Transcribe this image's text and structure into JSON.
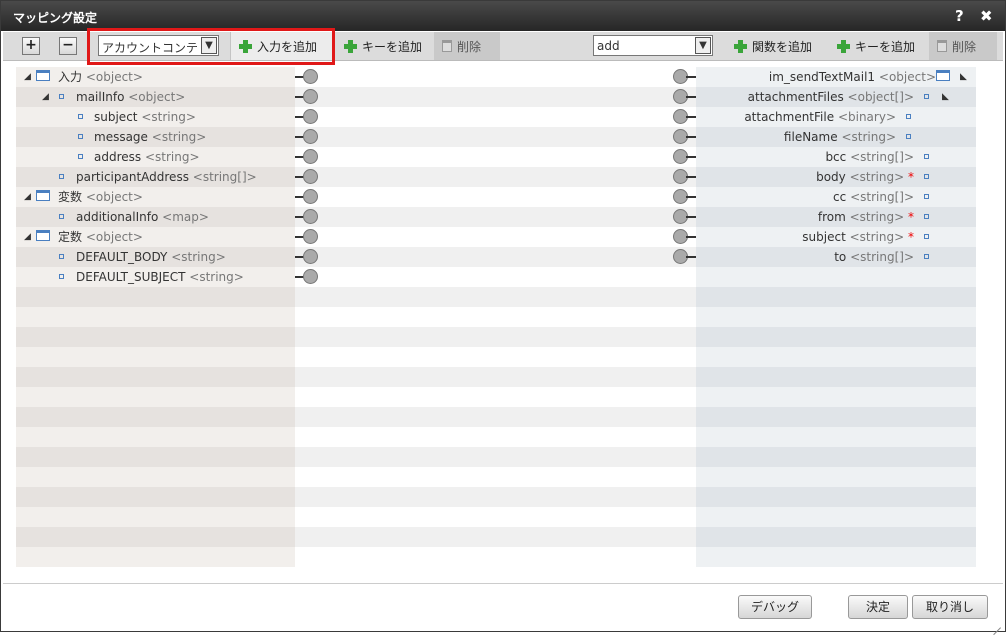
{
  "window": {
    "title": "マッピング設定",
    "help": "?",
    "close": "✖"
  },
  "toolbar": {
    "expand": "+",
    "collapse": "−",
    "left_select": "アカウントコンテキスト",
    "add_input": "入力を追加",
    "add_key_left": "キーを追加",
    "delete_left": "削除",
    "right_select": "add",
    "add_function": "関数を追加",
    "add_key_right": "キーを追加",
    "delete_right": "削除"
  },
  "left_tree": [
    {
      "name": "入力",
      "type": "<object>"
    },
    {
      "name": "mailInfo",
      "type": "<object>"
    },
    {
      "name": "subject",
      "type": "<string>"
    },
    {
      "name": "message",
      "type": "<string>"
    },
    {
      "name": "address",
      "type": "<string>"
    },
    {
      "name": "participantAddress",
      "type": "<string[]>"
    },
    {
      "name": "変数",
      "type": "<object>"
    },
    {
      "name": "additionalInfo",
      "type": "<map>"
    },
    {
      "name": "定数",
      "type": "<object>"
    },
    {
      "name": "DEFAULT_BODY",
      "type": "<string>"
    },
    {
      "name": "DEFAULT_SUBJECT",
      "type": "<string>"
    }
  ],
  "right_tree": [
    {
      "name": "im_sendTextMail1",
      "type": "<object>",
      "req": ""
    },
    {
      "name": "attachmentFiles",
      "type": "<object[]>",
      "req": ""
    },
    {
      "name": "attachmentFile",
      "type": "<binary>",
      "req": ""
    },
    {
      "name": "fileName",
      "type": "<string>",
      "req": ""
    },
    {
      "name": "bcc",
      "type": "<string[]>",
      "req": ""
    },
    {
      "name": "body",
      "type": "<string>",
      "req": "*"
    },
    {
      "name": "cc",
      "type": "<string[]>",
      "req": ""
    },
    {
      "name": "from",
      "type": "<string>",
      "req": "*"
    },
    {
      "name": "subject",
      "type": "<string>",
      "req": "*"
    },
    {
      "name": "to",
      "type": "<string[]>",
      "req": ""
    }
  ],
  "footer": {
    "debug": "デバッグ",
    "ok": "決定",
    "cancel": "取り消し"
  }
}
